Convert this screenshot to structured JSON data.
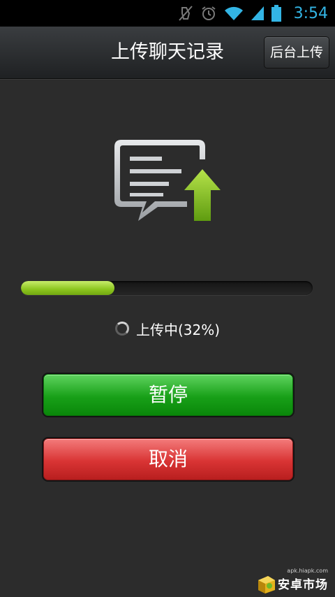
{
  "status_bar": {
    "time": "3:54",
    "icons": [
      "mute-icon",
      "alarm-icon",
      "wifi-icon",
      "signal-icon",
      "battery-icon"
    ],
    "accent_color": "#33b5e5"
  },
  "header": {
    "title": "上传聊天记录",
    "background_upload_label": "后台上传"
  },
  "illustration": {
    "icon": "chat-upload-icon"
  },
  "progress": {
    "fraction": 0.32,
    "status_text": "上传中(32%)"
  },
  "actions": {
    "pause_label": "暂停",
    "cancel_label": "取消"
  },
  "watermark": {
    "url": "apk.hiapk.com",
    "name": "安卓市场"
  },
  "colors": {
    "pause": "#18a018",
    "cancel": "#d93434",
    "progress": "#8cc51e"
  }
}
